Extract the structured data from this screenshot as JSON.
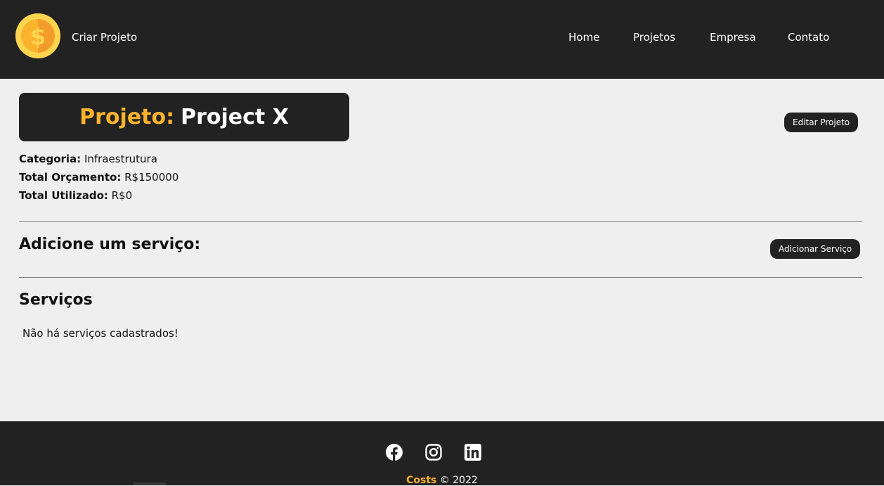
{
  "nav": {
    "create_link": "Criar Projeto",
    "items": [
      {
        "label": "Home"
      },
      {
        "label": "Projetos"
      },
      {
        "label": "Empresa"
      },
      {
        "label": "Contato"
      }
    ],
    "logo_icon": "coin-dollar-icon"
  },
  "project": {
    "title_prefix": "Projeto:",
    "name": "Project X",
    "edit_button": "Editar Projeto",
    "category_label": "Categoria:",
    "category_value": "Infraestrutura",
    "budget_label": "Total Orçamento:",
    "budget_value": "R$150000",
    "used_label": "Total Utilizado:",
    "used_value": "R$0"
  },
  "add_service": {
    "heading": "Adicione um serviço:",
    "button": "Adicionar Serviço"
  },
  "services": {
    "heading": "Serviços",
    "empty_message": "Não há serviços cadastrados!"
  },
  "footer": {
    "social_icons": [
      "facebook-icon",
      "instagram-icon",
      "linkedin-icon"
    ],
    "brand": "Costs",
    "copyright": "© 2022"
  },
  "colors": {
    "dark": "#222222",
    "accent": "#fbb32e",
    "background": "#efefef"
  }
}
